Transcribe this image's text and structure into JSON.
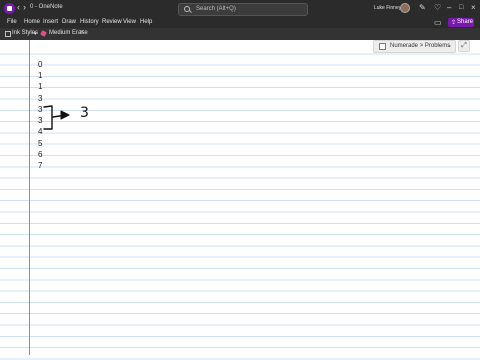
{
  "window": {
    "title": "0 - OneNote",
    "nav_back": "‹",
    "nav_forward": "›"
  },
  "search": {
    "placeholder": "Search (Alt+Q)"
  },
  "user": {
    "name": "Luke Finney"
  },
  "titlebar_icons": [
    "pen-icon",
    "lightbulb-icon",
    "minimize-icon",
    "maximize-icon",
    "close-icon"
  ],
  "menu": {
    "items": [
      "File",
      "Home",
      "Insert",
      "Draw",
      "History",
      "Review",
      "View",
      "Help"
    ],
    "share_label": "Share"
  },
  "toolbar": {
    "ink_styles_label": "Ink Styles",
    "eraser_label": "Medium Erase",
    "close_glyph": "×"
  },
  "tag": {
    "label": "Numerade > Problems",
    "chevron": "⌄"
  },
  "page": {
    "numbers": [
      "0",
      "1",
      "1",
      "3",
      "3",
      "3",
      "4",
      "5",
      "6",
      "7"
    ],
    "ink_result": "3"
  },
  "colors": {
    "titlebar_bg": "#2b2b2b",
    "accent": "#7719aa",
    "margin_line": "#e06c6c",
    "rule_line": "#cfe0f2"
  }
}
